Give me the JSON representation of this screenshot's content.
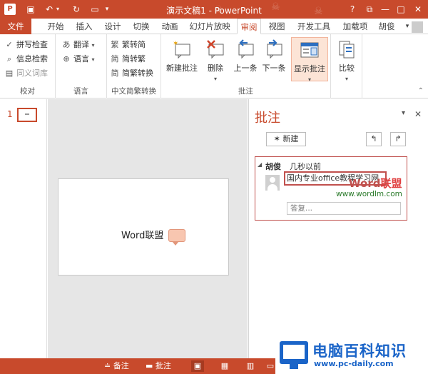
{
  "window": {
    "app_icon": "P",
    "title": "演示文稿1 - PowerPoint",
    "buttons": {
      "help": "?",
      "restore": "⧉",
      "minimize": "—",
      "maximize": "□",
      "close": "✕"
    }
  },
  "tabs": [
    {
      "label": "文件"
    },
    {
      "label": "开始"
    },
    {
      "label": "插入"
    },
    {
      "label": "设计"
    },
    {
      "label": "切换"
    },
    {
      "label": "动画"
    },
    {
      "label": "幻灯片放映"
    },
    {
      "label": "审阅"
    },
    {
      "label": "视图"
    },
    {
      "label": "开发工具"
    },
    {
      "label": "加载项"
    },
    {
      "label": "胡俊"
    }
  ],
  "ribbon": {
    "proofing": {
      "label": "校对",
      "spell_check": "拼写检查",
      "research": "信息检索",
      "thesaurus": "同义词库"
    },
    "language": {
      "label": "语言",
      "translate": "翻译",
      "language": "语言"
    },
    "chinese_conversion": {
      "label": "中文简繁转换",
      "to_traditional": "繁转简",
      "to_simplified": "简转繁",
      "convert": "简繁转换"
    },
    "comments": {
      "label": "批注",
      "new_comment": "新建批注",
      "delete": "删除",
      "previous": "上一条",
      "next": "下一条",
      "show_comments": "显示批注"
    },
    "compare": {
      "label": "比较"
    }
  },
  "thumbnails": [
    {
      "number": "1"
    }
  ],
  "slide": {
    "text": "Word联盟"
  },
  "comments_pane": {
    "title": "批注",
    "new_button": "新建",
    "comment": {
      "author": "胡俊",
      "time": "几秒以前",
      "text": "国内专业office教程学习网",
      "reply_placeholder": "答复..."
    }
  },
  "watermark": {
    "line1_a": "Word",
    "line1_b": "联盟",
    "url": "www.wordlm.com"
  },
  "statusbar": {
    "notes": "备注",
    "comments": "批注"
  },
  "logo": {
    "name": "电脑百科知识",
    "url": "www.pc-daily.com"
  },
  "colors": {
    "accent": "#c84a2c",
    "comment_border": "#c0504d"
  }
}
